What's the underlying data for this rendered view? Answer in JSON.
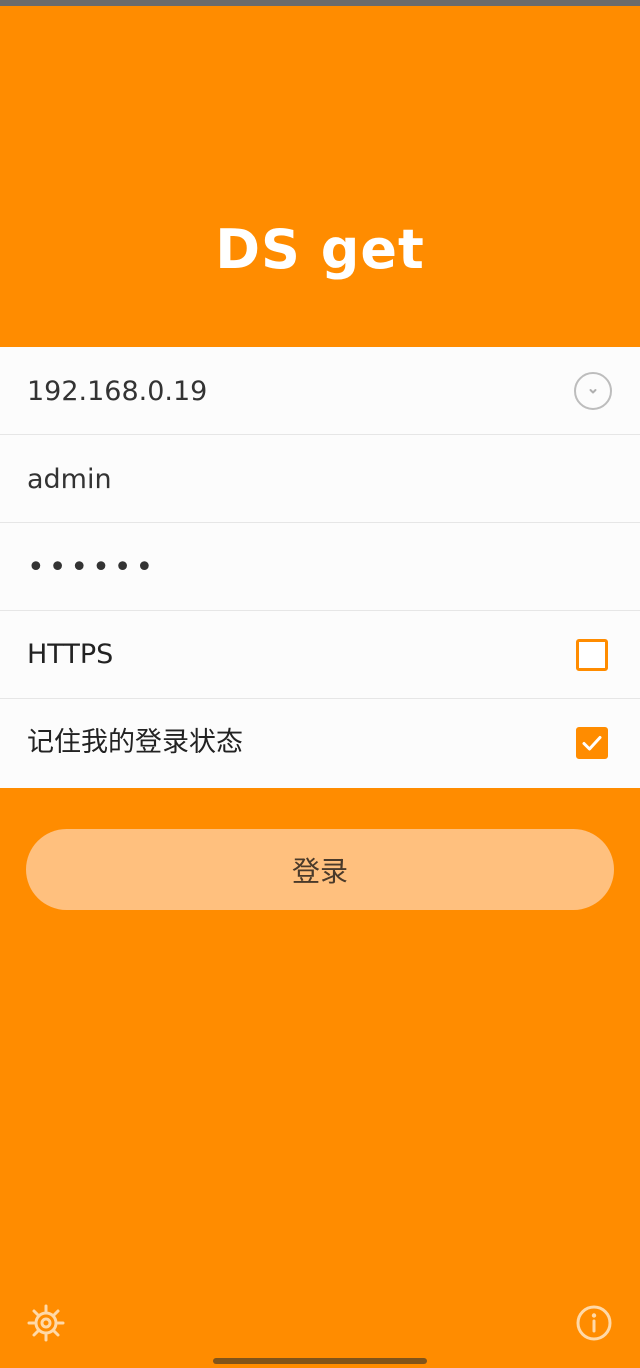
{
  "app": {
    "title": "DS get"
  },
  "form": {
    "server_address": "192.168.0.19",
    "username": "admin",
    "password": "••••••",
    "https_label": "HTTPS",
    "https_checked": false,
    "remember_label": "记住我的登录状态",
    "remember_checked": true
  },
  "login_button": {
    "label": "登录"
  },
  "icons": {
    "server_dropdown": "chevron-down-icon",
    "settings": "gear-icon",
    "info": "info-icon"
  },
  "colors": {
    "brand_orange": "#ff8c00",
    "button_fill": "#ffc07e",
    "panel_background": "#fcfcfc"
  }
}
